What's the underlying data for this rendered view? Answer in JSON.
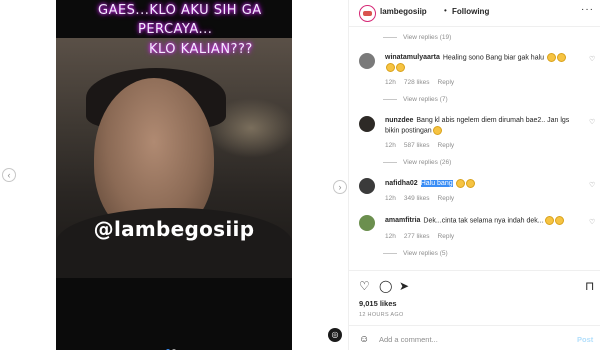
{
  "video": {
    "overlay_lines": [
      "GAES...KLO AKU SIH GA",
      "PERCAYA...",
      "KLO KALIAN???"
    ],
    "watermark": "@lambegosiip"
  },
  "header": {
    "username": "lambegosiip",
    "separator": "•",
    "follow_label": "Following",
    "more_label": "···"
  },
  "comments": [
    {
      "type": "replies",
      "label": "View replies (19)"
    },
    {
      "type": "comment",
      "username": "winatamulyaarta",
      "text": "Healing sono Bang biar gak halu",
      "emojis": 4,
      "time": "12h",
      "likes": "728 likes",
      "reply": "Reply",
      "avatar_color": "#7a7a7a"
    },
    {
      "type": "replies",
      "label": "View replies (7)"
    },
    {
      "type": "comment",
      "username": "nunzdee",
      "text": "Bang kl abis ngelem diem dirumah bae2.. Jan lgs bikin postingan",
      "emojis": 1,
      "time": "12h",
      "likes": "587 likes",
      "reply": "Reply",
      "avatar_color": "#2d2a26"
    },
    {
      "type": "replies",
      "label": "View replies (26)"
    },
    {
      "type": "comment",
      "username": "nafidha02",
      "text": "",
      "highlight": "Halu bang",
      "emojis": 2,
      "time": "12h",
      "likes": "349 likes",
      "reply": "Reply",
      "avatar_color": "#3b3b3b"
    },
    {
      "type": "comment",
      "username": "amamfitria",
      "text": "Dek...cinta tak selama nya indah dek...",
      "emojis": 2,
      "time": "12h",
      "likes": "277 likes",
      "reply": "Reply",
      "avatar_color": "#6b8f4e"
    },
    {
      "type": "replies",
      "label": "View replies (5)"
    }
  ],
  "actions": {
    "likes": "9,015 likes",
    "time_ago": "12 HOURS AGO",
    "add_comment_placeholder": "Add a comment...",
    "post_label": "Post"
  },
  "icons": {
    "like": "heart-icon",
    "comment": "comment-icon",
    "share": "share-icon",
    "save": "bookmark-icon",
    "emoji": "smile-icon",
    "sound": "mute-icon"
  },
  "colors": {
    "link_blue": "#3a8df5",
    "overlay_glow": "#c300ff"
  }
}
